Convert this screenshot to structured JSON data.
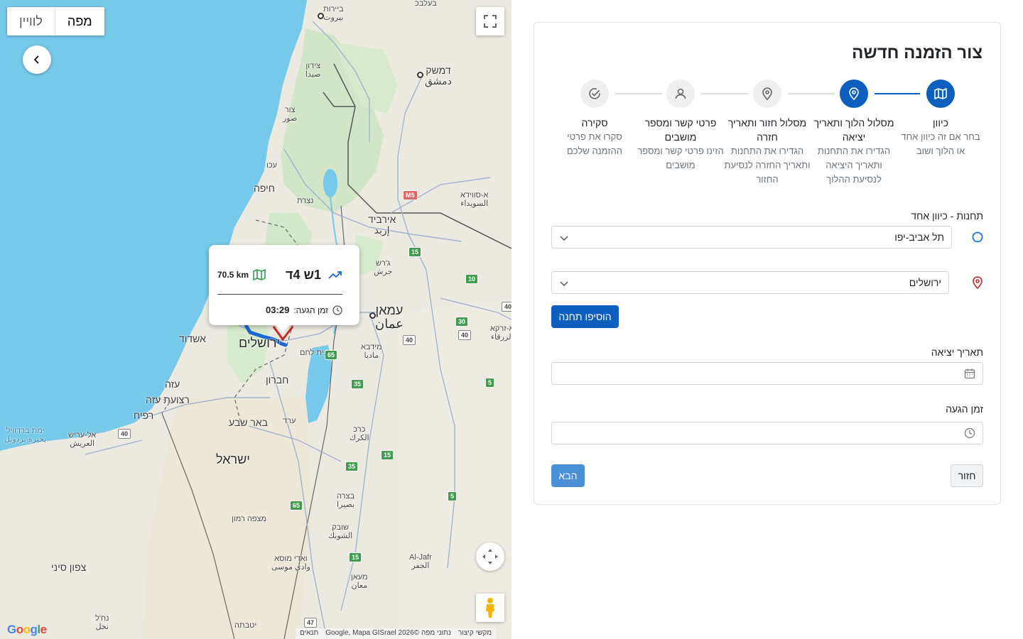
{
  "map": {
    "type_controls": {
      "map_label": "מפה",
      "satellite_label": "לוויין",
      "active": "map"
    },
    "route_popup": {
      "duration": "1ש 4ד",
      "distance": "70.5 km",
      "arrival_label": "זמן הגעה:",
      "arrival_time": "03:29"
    },
    "labels": {
      "beirut": "ביירות\nبيروت",
      "damascus": "דמשק\nدمشق",
      "sidon": "צידון\nصيدا",
      "tyre": "צור\nصور",
      "acre": "עכו",
      "haifa": "חיפה",
      "nazareth": "נצרת",
      "irbid": "אירביד\nإربد",
      "jerash": "ג'רש\nجرش",
      "amman": "עמאן\nعمان",
      "zarqa": "א-זרקא\nالزرقاء",
      "suwayda": "א-סווידא\nالسويداء",
      "ashdod": "אשדוד",
      "jerusalem": "ירושלים",
      "bethlehem": "בית לחם",
      "madaba": "מידבא\nمادبا",
      "hebron": "חברון",
      "gaza": "עזה",
      "gaza_strip": "רצועת עזה",
      "rafah": "רפיח",
      "beersheba": "באר שבע",
      "arad": "ערד",
      "karak": "כרכ\nالكرك",
      "arish": "אל-עריש\nالعريش",
      "bardawil": "ימת ברדוויל\nبحيرة بردويل",
      "israel": "ישראל",
      "bozrah": "בצרה\nبصيرا",
      "mitzpe": "מצפה רמון",
      "shobak": "שובק\nالشوبك",
      "wadi_musa": "ואדי מוסא\nوادي موسى",
      "sinai": "צפון סיני",
      "al_jafr": "Al-Jafr\nالجفر",
      "maan": "מעאן\nمعان",
      "nakhl": "נח'ל\nنخل",
      "yotvata": "יטבתה",
      "baalbek": "בעלבכ"
    },
    "shields": [
      "M5",
      "15",
      "10",
      "40",
      "30",
      "40",
      "65",
      "35",
      "5",
      "15",
      "35",
      "5",
      "65",
      "15",
      "47",
      "40",
      "40"
    ],
    "attribution": {
      "shortcuts": "מקשי קיצור",
      "data": "נתוני מפה ©2026 Google, Mapa GISrael",
      "terms": "תנאים",
      "google": "Google"
    }
  },
  "form": {
    "title": "צור הזמנה חדשה",
    "steps": [
      {
        "title": "כיוון",
        "desc": "בחר אם זה כיוון אחד או הלוך ושוב",
        "state": "active",
        "icon": "map-icon"
      },
      {
        "title": "מסלול הלוך ותאריך יציאה",
        "desc": "הגדירו את התחנות ותאריך היציאה לנסיעת ההלוך",
        "state": "active",
        "icon": "pin-icon"
      },
      {
        "title": "מסלול חזור ותאריך חזרה",
        "desc": "הגדירו את התחנות ותאריך החזרה לנסיעת החזור",
        "state": "inactive",
        "icon": "pin-icon"
      },
      {
        "title": "פרטי קשר ומספר מושבים",
        "desc": "הזינו פרטי קשר ומספר מושבים",
        "state": "inactive",
        "icon": "user-icon"
      },
      {
        "title": "סקירה",
        "desc": "סקרו את פרטי ההזמנה שלכם",
        "state": "inactive",
        "icon": "check-circle-icon"
      }
    ],
    "stations_label": "תחנות - כיוון אחד",
    "origin_value": "תל אביב-יפו",
    "destination_value": "ירושלים",
    "add_station_label": "הוסיפו תחנה",
    "departure_date_label": "תאריך יציאה",
    "departure_date_value": "",
    "arrival_time_label": "זמן הגעה",
    "arrival_time_value": "",
    "back_label": "חזור",
    "next_label": "הבא",
    "colors": {
      "primary": "#0d5fbf",
      "next": "#4a90d9",
      "origin_ring": "#1a73e8",
      "dest_pin": "#c62828",
      "route": "#1a66d6"
    }
  }
}
